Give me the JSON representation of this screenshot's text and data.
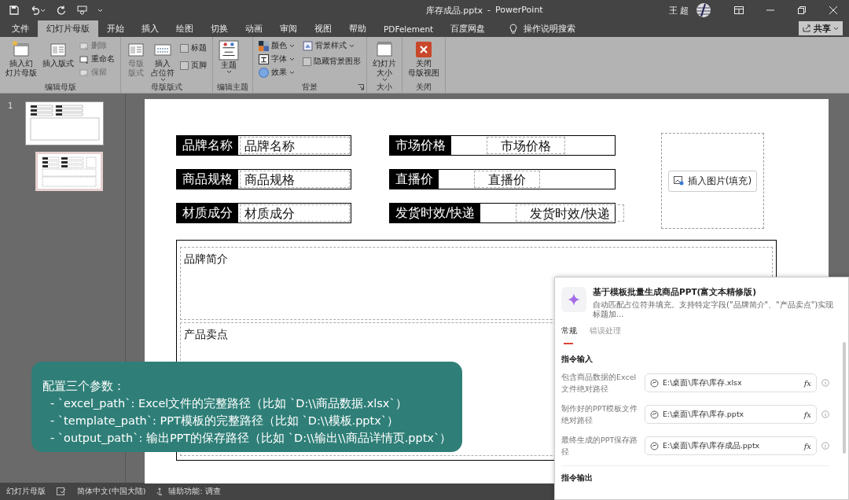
{
  "title_bar": {
    "document": "库存成品.pptx",
    "separator": "-",
    "app": "PowerPoint",
    "user": "王 超"
  },
  "menu_tabs": [
    {
      "label": "文件",
      "selected": false
    },
    {
      "label": "幻灯片母版",
      "selected": true
    },
    {
      "label": "开始",
      "selected": false
    },
    {
      "label": "插入",
      "selected": false
    },
    {
      "label": "绘图",
      "selected": false
    },
    {
      "label": "切换",
      "selected": false
    },
    {
      "label": "动画",
      "selected": false
    },
    {
      "label": "审阅",
      "selected": false
    },
    {
      "label": "视图",
      "selected": false
    },
    {
      "label": "帮助",
      "selected": false
    },
    {
      "label": "PDFelement",
      "selected": false
    },
    {
      "label": "百度网盘",
      "selected": false
    }
  ],
  "tell_me": "操作说明搜索",
  "share": "共享",
  "ribbon_groups": [
    {
      "label": "编辑母版",
      "items": [
        {
          "kind": "big",
          "label_lines": [
            "插入幻",
            "灯片母版"
          ],
          "disabled": false
        },
        {
          "kind": "big",
          "label_lines": [
            "插入版式"
          ],
          "disabled": false
        },
        {
          "kind": "small",
          "label": "删除",
          "disabled": true
        },
        {
          "kind": "small",
          "label": "重命名",
          "disabled": false
        },
        {
          "kind": "small",
          "label": "保留",
          "disabled": true
        }
      ]
    },
    {
      "label": "母版版式",
      "items": [
        {
          "kind": "big",
          "label_lines": [
            "母版",
            "版式"
          ],
          "disabled": true
        },
        {
          "kind": "big",
          "label_lines": [
            "插入",
            "占位符"
          ],
          "dropdown": true,
          "disabled": false
        },
        {
          "kind": "check",
          "label": "标题",
          "checked": false
        },
        {
          "kind": "check",
          "label": "页脚",
          "checked": false
        }
      ]
    },
    {
      "label": "编辑主题",
      "items": [
        {
          "kind": "big",
          "label_lines": [
            "主题"
          ],
          "dropdown": true,
          "disabled": false
        }
      ]
    },
    {
      "label": "背景",
      "launcher": true,
      "items": [
        {
          "kind": "small",
          "label": "颜色",
          "dropdown": true,
          "disabled": false
        },
        {
          "kind": "small",
          "label": "字体",
          "dropdown": true,
          "disabled": false
        },
        {
          "kind": "small",
          "label": "效果",
          "dropdown": true,
          "disabled": false
        },
        {
          "kind": "small",
          "label": "背景样式",
          "dropdown": true,
          "disabled": false
        },
        {
          "kind": "check",
          "label": "隐藏背景图形",
          "checked": false
        }
      ]
    },
    {
      "label": "大小",
      "items": [
        {
          "kind": "big",
          "label_lines": [
            "幻灯片",
            "大小"
          ],
          "dropdown": true,
          "disabled": false
        }
      ]
    },
    {
      "label": "关闭",
      "items": [
        {
          "kind": "big",
          "label_lines": [
            "关闭",
            "母版视图"
          ],
          "disabled": false
        }
      ]
    }
  ],
  "thumbnails": [
    {
      "number": "1",
      "selected": false,
      "kind": "master"
    },
    {
      "selected": true,
      "kind": "layout"
    }
  ],
  "slide": {
    "left_fields": [
      {
        "label": "品牌名称",
        "value": "品牌名称"
      },
      {
        "label": "商品规格",
        "value": "商品规格"
      },
      {
        "label": "材质成分",
        "value": "材质成分"
      }
    ],
    "right_fields": [
      {
        "label": "市场价格",
        "value": "市场价格"
      },
      {
        "label": "直播价",
        "value": "直播价"
      },
      {
        "label": "发货时效/快递",
        "value": "发货时效/快递"
      }
    ],
    "image_button": "插入图片(填充)",
    "text_areas": [
      "品牌简介",
      "产品卖点"
    ]
  },
  "callout": {
    "title": "配置三个参数：",
    "lines": [
      "- `excel_path`: Excel文件的完整路径（比如 `D:\\\\商品数据.xlsx`）",
      "- `template_path`: PPT模板的完整路径（比如 `D:\\\\模板.pptx`）",
      "- `output_path`: 输出PPT的保存路径（比如 `D:\\\\输出\\\\商品详情页.pptx`）"
    ]
  },
  "panel": {
    "title": "基于模板批量生成商品PPT(富文本精修版)",
    "description": "自动匹配占位符并填充。支持特定字段(\"品牌简介\"、\"产品卖点\")实现标题加...",
    "tabs": [
      {
        "label": "常规",
        "selected": true
      },
      {
        "label": "错误处理",
        "selected": false
      }
    ],
    "input_section": "指令输入",
    "fields": [
      {
        "label": "包含商品数据的Excel文件绝对路径",
        "value": "E:\\桌面\\库存\\库存.xlsx",
        "formula_button": "fx"
      },
      {
        "label": "制作好的PPT模板文件绝对路径",
        "value": "E:\\桌面\\库存\\库存.pptx",
        "formula_button": "fx"
      },
      {
        "label": "最终生成的PPT保存路径",
        "value": "E:\\桌面\\库存\\库存成品.pptx",
        "formula_button": "fx"
      }
    ],
    "output_section": "指令输出"
  },
  "status_bar": {
    "view": "幻灯片母版",
    "language": "简体中文(中国大陆)",
    "accessibility": "辅助功能: 调查"
  }
}
